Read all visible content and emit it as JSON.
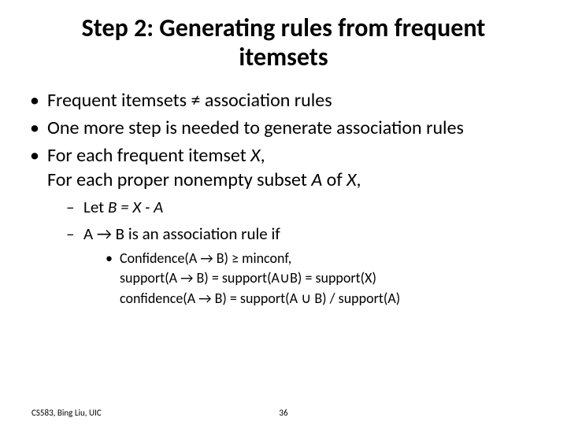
{
  "title": "Step 2: Generating rules from frequent itemsets",
  "bullets": {
    "b1": "Frequent itemsets ≠ association rules",
    "b2": "One more step is needed to generate association rules",
    "b3a": "For each frequent itemset ",
    "b3a_it": "X",
    "b3a_tail": ",",
    "b3b": "For each proper nonempty subset ",
    "b3b_it": "A",
    "b3b_mid": " of ",
    "b3b_it2": "X",
    "b3b_tail": ","
  },
  "sub": {
    "s1_pre": "Let ",
    "s1_it": "B = X - A",
    "s2_pre": "",
    "s2_text": "A → B is an association rule if"
  },
  "subsub": {
    "l1": "Confidence(A → B) ≥ minconf,",
    "l2": "support(A → B) = support(A∪B) = support(X)",
    "l3": "confidence(A → B) = support(A ∪ B) / support(A)"
  },
  "footer": {
    "left": "CS583, Bing Liu, UIC",
    "page": "36"
  }
}
